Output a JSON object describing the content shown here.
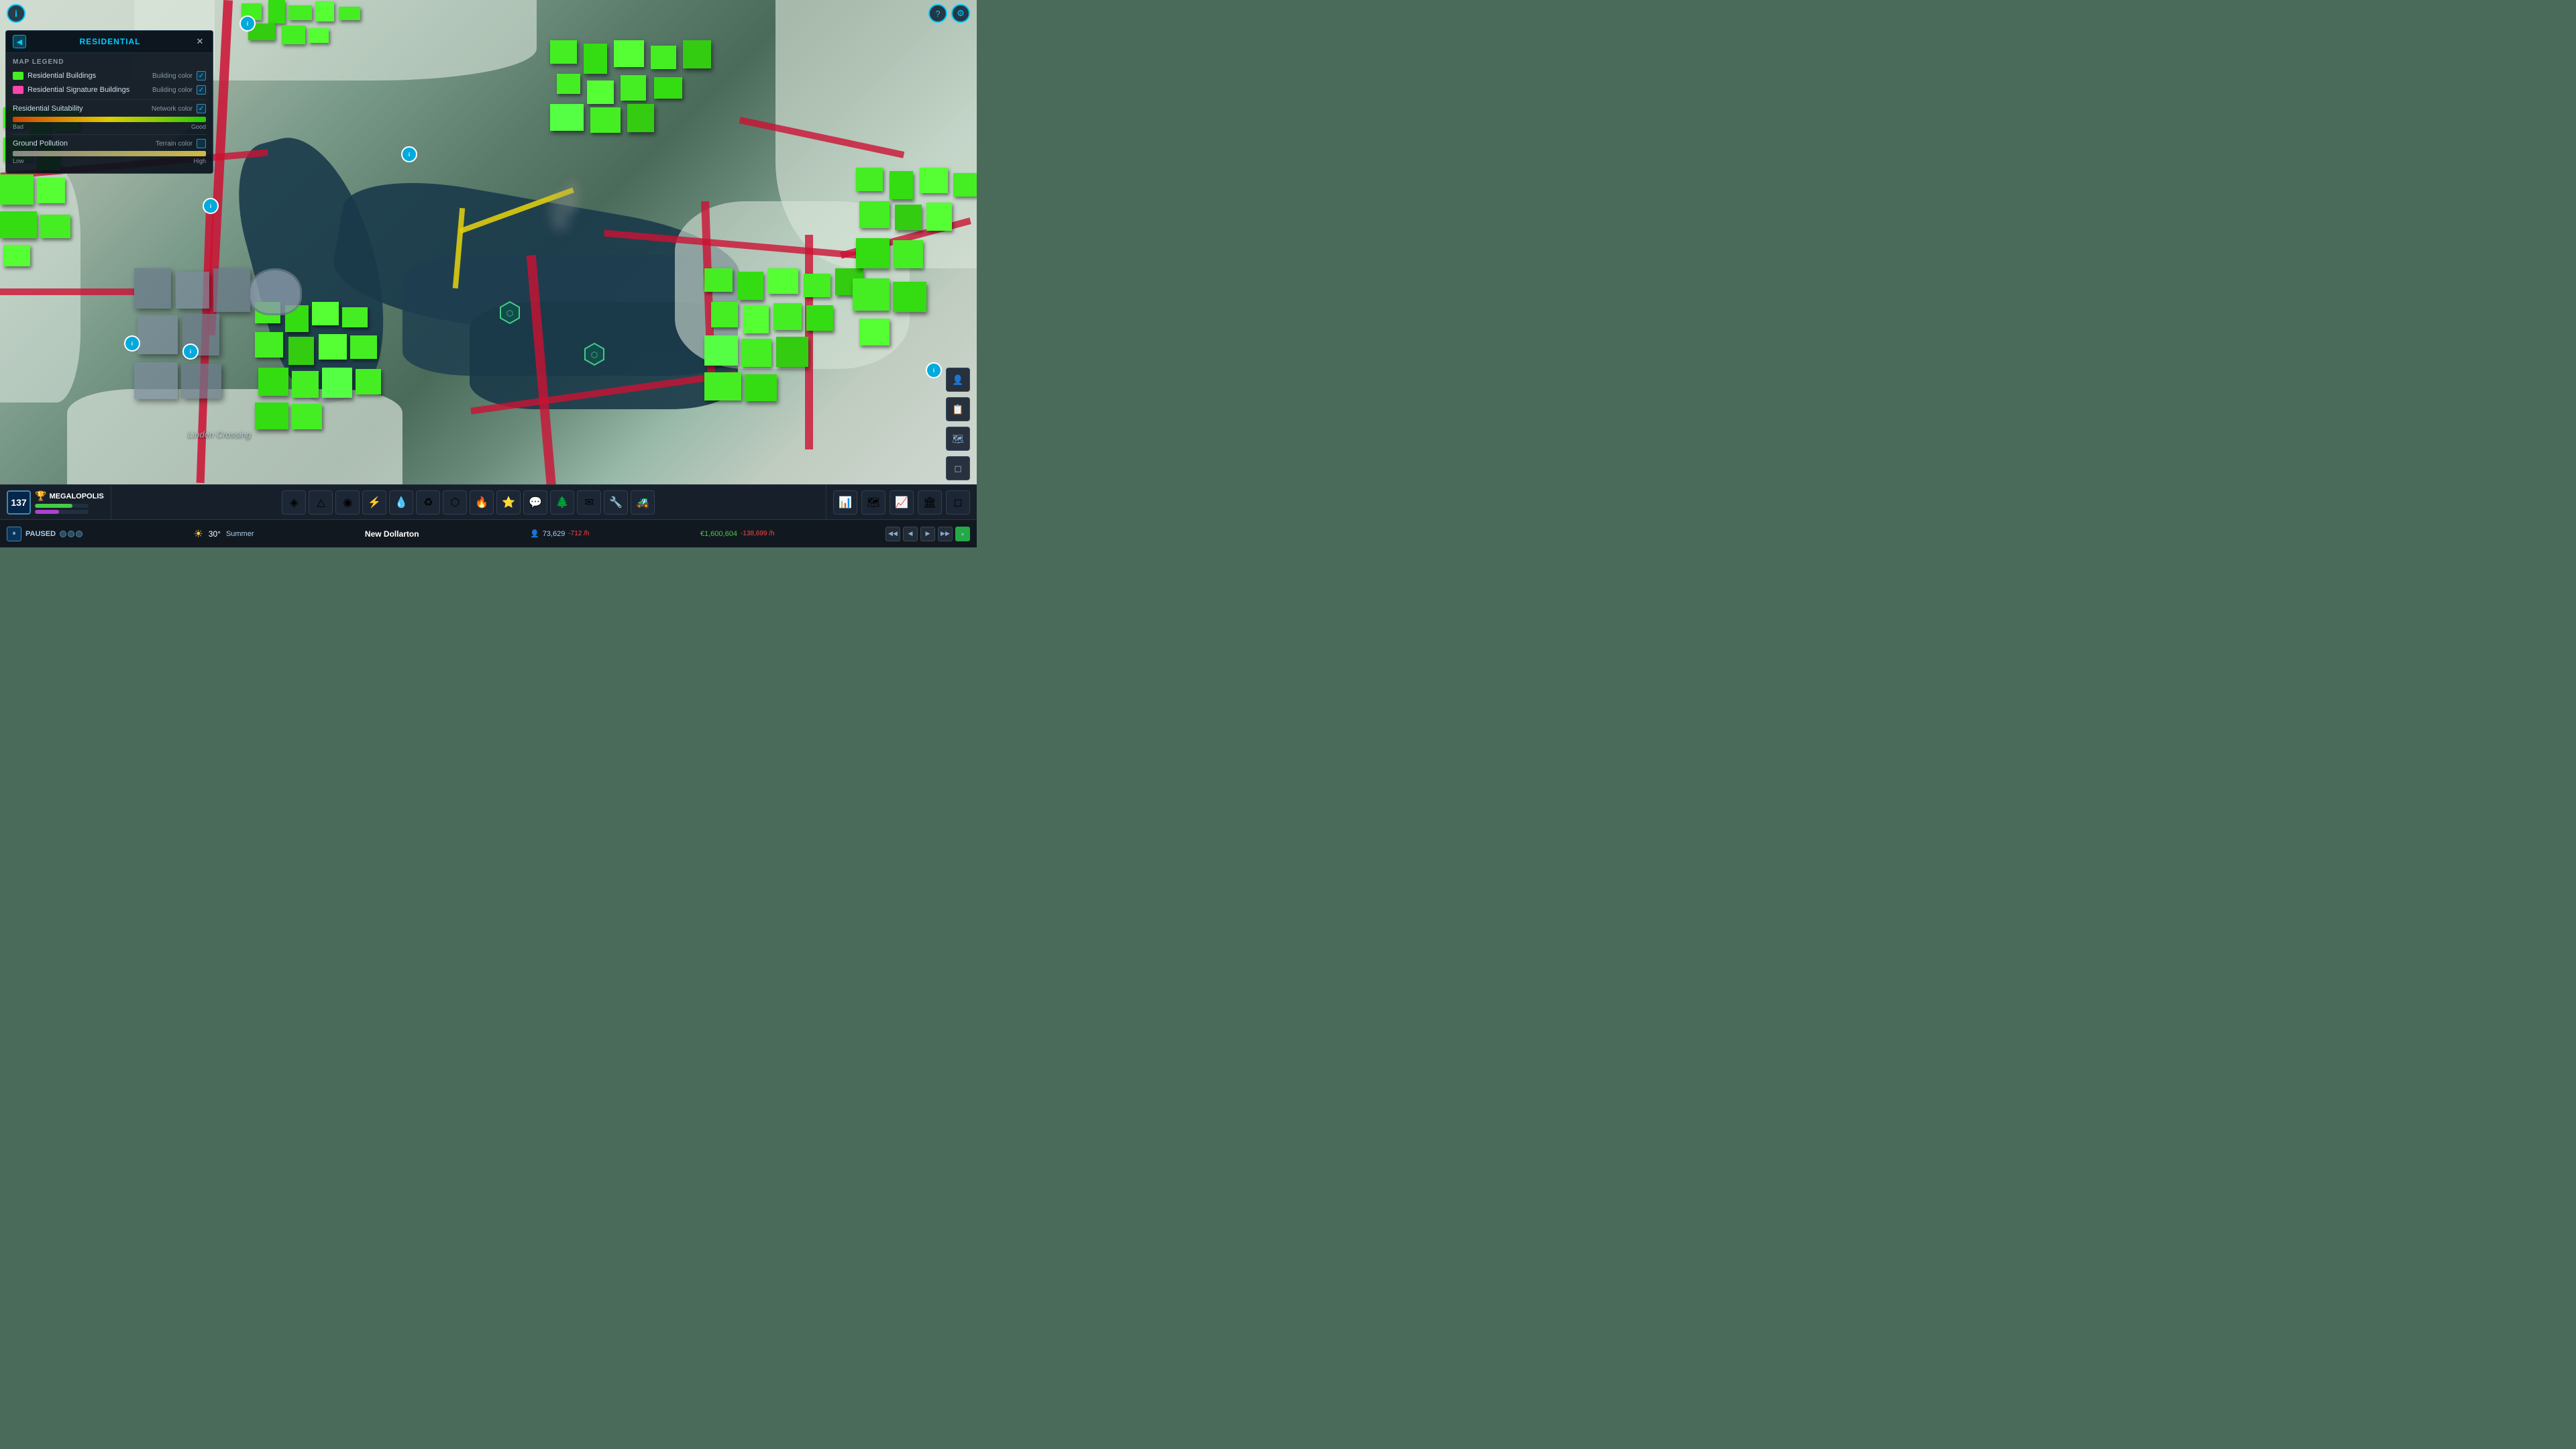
{
  "topBar": {
    "infoIcon": "i",
    "helpIcon": "?",
    "settingsIcon": "⚙"
  },
  "legendPanel": {
    "title": "RESIDENTIAL",
    "backLabel": "◀",
    "closeLabel": "✕",
    "mapLegendLabel": "MAP LEGEND",
    "items": [
      {
        "label": "Residential Buildings",
        "colorLabel": "Building color",
        "swatchColor": "#44ee22",
        "checked": true
      },
      {
        "label": "Residential Signature Buildings",
        "colorLabel": "Building color",
        "swatchColor": "#ff44aa",
        "checked": true
      }
    ],
    "suitability": {
      "label": "Residential Suitability",
      "colorLabel": "Network color",
      "checked": true,
      "gradientBad": "Bad",
      "gradientGood": "Good"
    },
    "groundPollution": {
      "label": "Ground Pollution",
      "colorLabel": "Terrain color",
      "checked": false,
      "rangeLow": "Low",
      "rangeHigh": "High"
    }
  },
  "cityMap": {
    "cityLabel": "Linden Crossing"
  },
  "toolbar": {
    "cityLevel": "137",
    "cityRankIcon": "🏆",
    "cityName": "MEGALOPOLIS",
    "bar1Color": "#44cc44",
    "bar1Width": "70%",
    "bar2Color": "#aa44cc",
    "bar2Width": "45%",
    "buttons": [
      {
        "icon": "◈",
        "label": "zones",
        "active": false
      },
      {
        "icon": "△",
        "label": "roads",
        "active": false
      },
      {
        "icon": "◉",
        "label": "services",
        "active": false
      },
      {
        "icon": "⚡",
        "label": "electricity",
        "active": false
      },
      {
        "icon": "💧",
        "label": "water",
        "active": false
      },
      {
        "icon": "♻",
        "label": "health",
        "active": false
      },
      {
        "icon": "⬡",
        "label": "districts",
        "active": false
      },
      {
        "icon": "🔥",
        "label": "fire",
        "active": false
      },
      {
        "icon": "⭐",
        "label": "police",
        "active": false
      },
      {
        "icon": "✉",
        "label": "education",
        "active": false
      },
      {
        "icon": "🌲",
        "label": "parks",
        "active": false
      },
      {
        "icon": "💬",
        "label": "comms",
        "active": false
      },
      {
        "icon": "🔧",
        "label": "industry",
        "active": false
      },
      {
        "icon": "🚜",
        "label": "transport",
        "active": false
      }
    ],
    "rightButtons": [
      {
        "icon": "📊",
        "label": "statistics"
      },
      {
        "icon": "🗺",
        "label": "map"
      },
      {
        "icon": "📈",
        "label": "charts"
      },
      {
        "icon": "🏛",
        "label": "buildings"
      },
      {
        "icon": "◻",
        "label": "expand"
      }
    ]
  },
  "bottomBar": {
    "pauseIcon": "⏸",
    "pausedLabel": "PAUSED",
    "speedDots": 3,
    "weatherIcon": "☀",
    "temperature": "30°",
    "season": "Summer",
    "cityName": "New Dollarton",
    "populationIcon": "👤",
    "population": "73,629",
    "populationChange": "-712 /h",
    "moneyIcon": "€",
    "money": "€1,600,604",
    "moneyChange": "-138,699 /h",
    "controls": [
      "◀◀",
      "◀",
      "▶",
      "▶▶"
    ]
  },
  "rightPanel": {
    "buttons": [
      {
        "icon": "👤",
        "label": "citizens"
      },
      {
        "icon": "📋",
        "label": "journal"
      },
      {
        "icon": "🌐",
        "label": "map-view"
      },
      {
        "icon": "◻",
        "label": "expand-right"
      }
    ]
  }
}
